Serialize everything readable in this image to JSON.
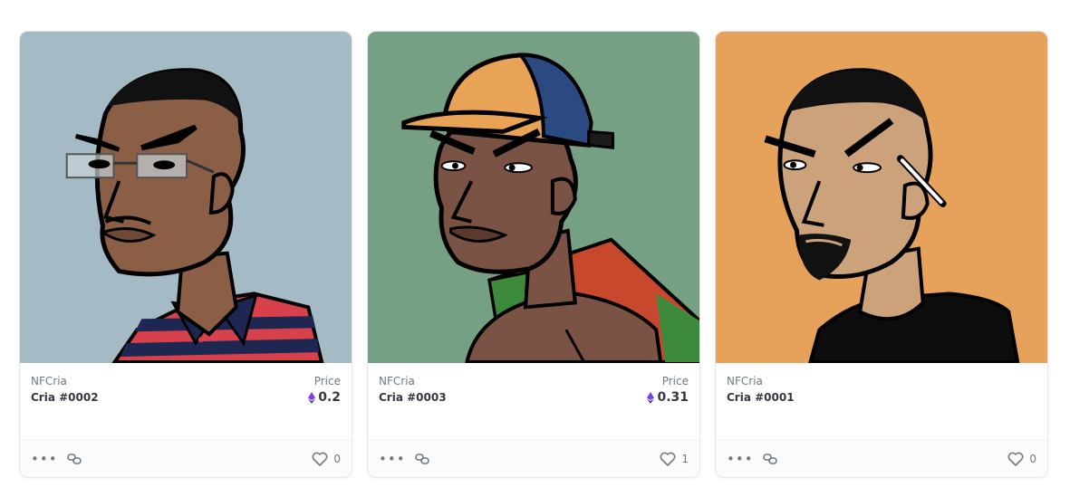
{
  "cards": [
    {
      "collection": "NFCria",
      "name": "Cria #0002",
      "price_label": "Price",
      "price": "0.2",
      "likes": "0",
      "bg": "#a4bac4"
    },
    {
      "collection": "NFCria",
      "name": "Cria #0003",
      "price_label": "Price",
      "price": "0.31",
      "likes": "1",
      "bg": "#76a083"
    },
    {
      "collection": "NFCria",
      "name": "Cria #0001",
      "price_label": "",
      "price": "",
      "likes": "0",
      "bg": "#e6a25a"
    }
  ],
  "icons": {
    "more": "more-horizontal-icon",
    "link": "link-icon",
    "like": "heart-icon",
    "currency": "ethereum-icon"
  },
  "colors": {
    "eth": "#7b3fe4",
    "text_dark": "#353840",
    "text_muted": "#707a83"
  }
}
